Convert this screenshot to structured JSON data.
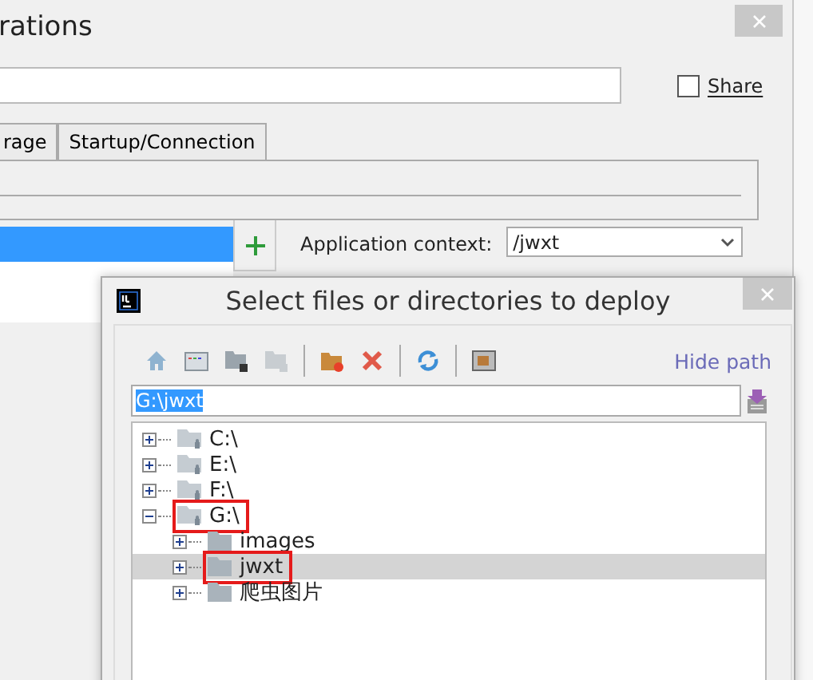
{
  "background_window": {
    "title": "rations",
    "share": {
      "label": "Share",
      "checked": false
    },
    "tabs": [
      {
        "label": "rage",
        "selected": false
      },
      {
        "label": "Startup/Connection",
        "selected": false
      }
    ],
    "list_items": [
      {
        "selected": true
      }
    ],
    "application_context": {
      "label": "Application context:",
      "value": "/jwxt"
    }
  },
  "dialog": {
    "title": "Select files or directories to deploy",
    "hide_path": "Hide path",
    "path": "G:\\jwxt",
    "tree": [
      {
        "label": "C:\\",
        "kind": "drive",
        "expanded": false,
        "selected": false,
        "marked": false
      },
      {
        "label": "E:\\",
        "kind": "drive",
        "expanded": false,
        "selected": false,
        "marked": false
      },
      {
        "label": "F:\\",
        "kind": "drive",
        "expanded": false,
        "selected": false,
        "marked": false
      },
      {
        "label": "G:\\",
        "kind": "drive",
        "expanded": true,
        "selected": false,
        "marked": true,
        "children": [
          {
            "label": "images",
            "kind": "folder",
            "expanded": false,
            "selected": false,
            "marked": false
          },
          {
            "label": "jwxt",
            "kind": "folder",
            "expanded": false,
            "selected": true,
            "marked": true
          },
          {
            "label": "爬虫图片",
            "kind": "folder",
            "expanded": false,
            "selected": false,
            "marked": false
          }
        ]
      }
    ]
  }
}
